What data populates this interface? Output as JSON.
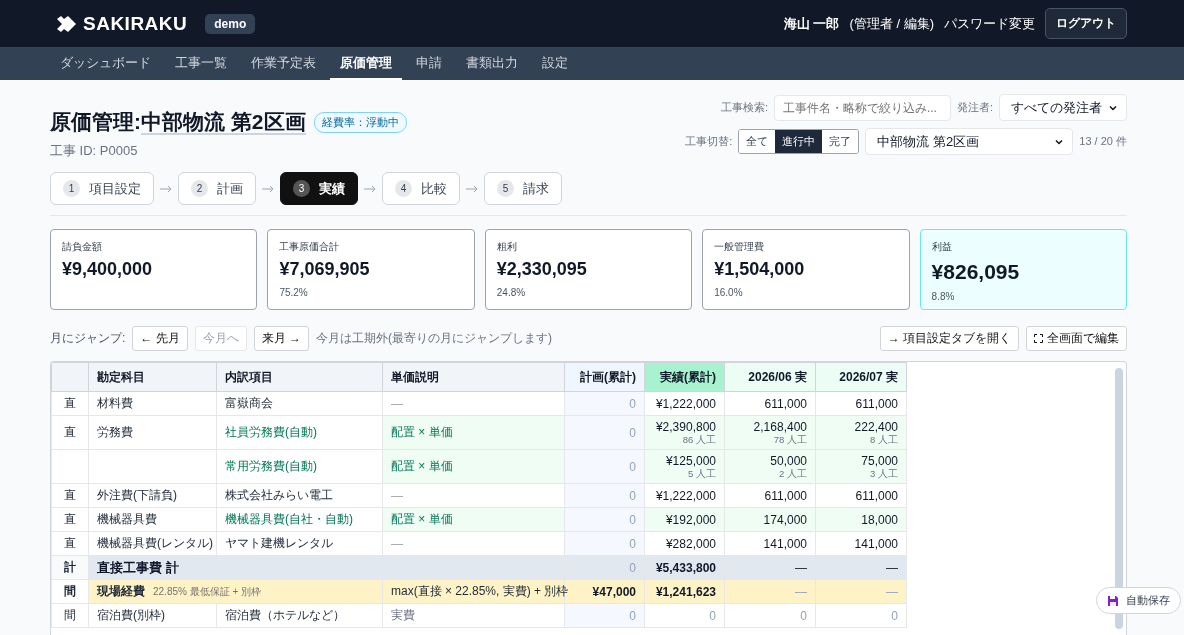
{
  "header": {
    "logo": "SAKIRAKU",
    "env": "demo",
    "user": "海山 一郎",
    "role": "(管理者 / 編集)",
    "password_link": "パスワード変更",
    "logout": "ログアウト"
  },
  "nav": [
    {
      "label": "ダッシュボード",
      "selected": false
    },
    {
      "label": "工事一覧",
      "selected": false
    },
    {
      "label": "作業予定表",
      "selected": false
    },
    {
      "label": "原価管理",
      "selected": true
    },
    {
      "label": "申請",
      "selected": false
    },
    {
      "label": "書類出力",
      "selected": false
    },
    {
      "label": "設定",
      "selected": false
    }
  ],
  "title": {
    "prefix": "原価管理:",
    "name": "中部物流 第2区画",
    "badge": "経費率：浮動中",
    "project_id": "工事 ID: P0005"
  },
  "filters": {
    "search_label": "工事検索:",
    "search_placeholder": "工事件名・略称で絞り込み...",
    "client_label": "発注者:",
    "client_value": "すべての発注者",
    "switch_label": "工事切替:",
    "toggles": [
      {
        "label": "全て",
        "selected": false
      },
      {
        "label": "進行中",
        "selected": true
      },
      {
        "label": "完了",
        "selected": false
      }
    ],
    "project_value": "中部物流 第2区画",
    "count": "13 / 20 件"
  },
  "steps": [
    {
      "number": "1",
      "label": "項目設定",
      "selected": false
    },
    {
      "number": "2",
      "label": "計画",
      "selected": false
    },
    {
      "number": "3",
      "label": "実績",
      "selected": true
    },
    {
      "number": "4",
      "label": "比較",
      "selected": false
    },
    {
      "number": "5",
      "label": "請求",
      "selected": false
    }
  ],
  "cards": [
    {
      "label": "請負金額",
      "value": "¥9,400,000",
      "highlight": false
    },
    {
      "label": "工事原価合計",
      "value": "¥7,069,905",
      "sub": "75.2%",
      "highlight": false
    },
    {
      "label": "粗利",
      "value": "¥2,330,095",
      "sub": "24.8%",
      "highlight": false
    },
    {
      "label": "一般管理費",
      "value": "¥1,504,000",
      "sub": "16.0%",
      "highlight": false
    },
    {
      "label": "利益",
      "value": "¥826,095",
      "sub": "8.8%",
      "highlight": true
    }
  ],
  "jump": {
    "label": "月にジャンプ:",
    "buttons": [
      {
        "label": "← 先月",
        "disabled": false
      },
      {
        "label": "今月へ",
        "disabled": true
      },
      {
        "label": "来月 →",
        "disabled": false
      }
    ],
    "note": "今月は工期外(最寄りの月にジャンプします)",
    "actions": [
      "→ 項目設定タブを開く",
      "全画面で編集"
    ]
  },
  "table": {
    "columns": [
      "勘定科目",
      "内訳項目",
      "単価説明",
      "計画(累計)",
      "実績(累計)",
      "2026/06 実",
      "2026/07 実"
    ],
    "rows": [
      {
        "kind": "line",
        "mark": "直",
        "account": "材料費",
        "item": "富嶽商会",
        "desc": "—",
        "auto": false,
        "plan": {
          "value": "0",
          "muted": true
        },
        "actual": {
          "value": "¥1,222,000"
        },
        "months": [
          {
            "value": "611,000"
          },
          {
            "value": "611,000"
          }
        ]
      },
      {
        "kind": "line",
        "mark": "直",
        "account": "労務費",
        "item": "社員労務費(自動)",
        "desc": "配置 × 単価",
        "auto": true,
        "plan": {
          "value": "0",
          "muted": true
        },
        "actual": {
          "value": "¥2,390,800",
          "sub": "86 人工"
        },
        "months": [
          {
            "value": "2,168,400",
            "sub": "78 人工"
          },
          {
            "value": "222,400",
            "sub": "8 人工"
          }
        ]
      },
      {
        "kind": "line",
        "item": "常用労務費(自動)",
        "desc": "配置 × 単価",
        "auto": true,
        "plan": {
          "value": "0",
          "muted": true
        },
        "actual": {
          "value": "¥125,000",
          "sub": "5 人工"
        },
        "months": [
          {
            "value": "50,000",
            "sub": "2 人工"
          },
          {
            "value": "75,000",
            "sub": "3 人工"
          }
        ]
      },
      {
        "kind": "line",
        "mark": "直",
        "account": "外注費(下請負)",
        "item": "株式会社みらい電工",
        "desc": "—",
        "auto": false,
        "plan": {
          "value": "0",
          "muted": true
        },
        "actual": {
          "value": "¥1,222,000"
        },
        "months": [
          {
            "value": "611,000"
          },
          {
            "value": "611,000"
          }
        ]
      },
      {
        "kind": "line",
        "mark": "直",
        "account": "機械器具費",
        "item": "機械器具費(自社・自動)",
        "desc": "配置 × 単価",
        "auto": true,
        "plan": {
          "value": "0",
          "muted": true
        },
        "actual": {
          "value": "¥192,000"
        },
        "months": [
          {
            "value": "174,000"
          },
          {
            "value": "18,000"
          }
        ]
      },
      {
        "kind": "line",
        "mark": "直",
        "account": "機械器具費(レンタル)",
        "item": "ヤマト建機レンタル",
        "desc": "—",
        "auto": false,
        "plan": {
          "value": "0",
          "muted": true
        },
        "actual": {
          "value": "¥282,000"
        },
        "months": [
          {
            "value": "141,000"
          },
          {
            "value": "141,000"
          }
        ]
      },
      {
        "kind": "total",
        "mark": "計",
        "account": "直接工事費 計",
        "plan": {
          "value": "0",
          "muted": true
        },
        "actual": {
          "value": "¥5,433,800"
        },
        "months": [
          {
            "value": "—"
          },
          {
            "value": "—"
          }
        ]
      },
      {
        "kind": "overhead",
        "mark": "間",
        "account": "現場経費",
        "note": "22.85% 最低保証 + 別枠",
        "desc": "max(直接 × 22.85%, 実費) + 別枠",
        "plan": {
          "value": "¥47,000"
        },
        "actual": {
          "value": "¥1,241,623"
        },
        "months": [
          {
            "value": "—",
            "muted": true
          },
          {
            "value": "—",
            "muted": true
          }
        ]
      },
      {
        "kind": "line",
        "mark": "間",
        "account": "宿泊費(別枠)",
        "item": "宿泊費（ホテルなど）",
        "desc": "実費",
        "auto": false,
        "desc_muted": true,
        "plan": {
          "value": "0",
          "muted": true
        },
        "actual": {
          "value": "0",
          "muted": true
        },
        "months": [
          {
            "value": "0",
            "muted": true
          },
          {
            "value": "0",
            "muted": true
          }
        ]
      }
    ]
  },
  "autosave": "自動保存"
}
